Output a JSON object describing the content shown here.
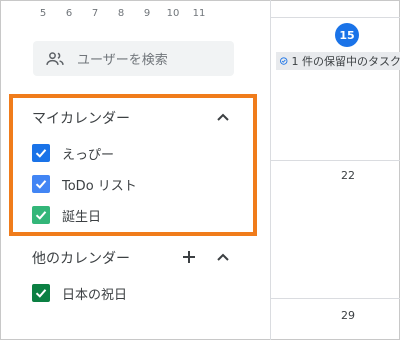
{
  "mini_calendar": {
    "days": [
      "5",
      "6",
      "7",
      "8",
      "9",
      "10",
      "11"
    ]
  },
  "search": {
    "placeholder": "ユーザーを検索"
  },
  "my_calendars": {
    "title": "マイカレンダー",
    "items": [
      {
        "label": "えっぴー",
        "color": "#1a73e8",
        "checked": true
      },
      {
        "label": "ToDo リスト",
        "color": "#4285f4",
        "checked": true
      },
      {
        "label": "誕生日",
        "color": "#33b679",
        "checked": true
      }
    ]
  },
  "other_calendars": {
    "title": "他のカレンダー",
    "items": [
      {
        "label": "日本の祝日",
        "color": "#0b8043",
        "checked": true
      }
    ]
  },
  "week_view": {
    "today": "15",
    "task_chip": "1 件の保留中のタスク",
    "day_22": "22",
    "day_29": "29"
  },
  "colors": {
    "highlight": "#f07c1b",
    "today": "#1a73e8"
  }
}
